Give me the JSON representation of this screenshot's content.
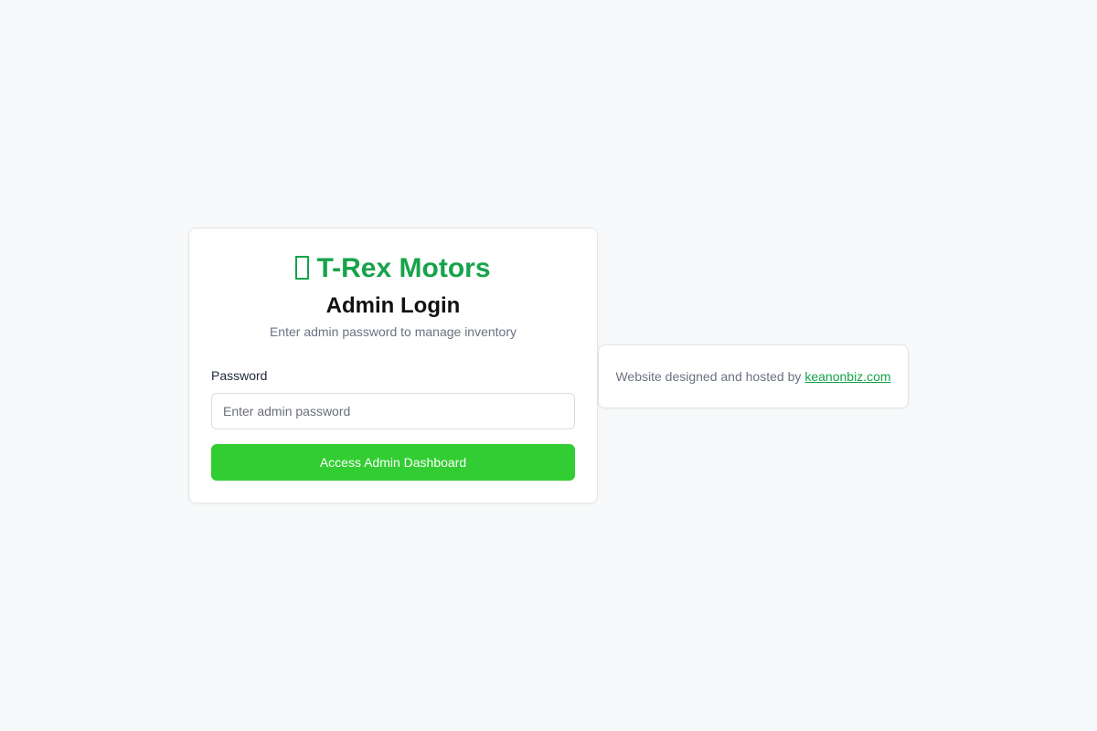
{
  "brand": {
    "icon": "dinosaur-icon",
    "name": "T-Rex Motors",
    "color": "#16a34a"
  },
  "login": {
    "title": "Admin Login",
    "subtitle": "Enter admin password to manage inventory",
    "password_label": "Password",
    "password_placeholder": "Enter admin password",
    "password_value": "",
    "submit_label": "Access Admin Dashboard",
    "button_color": "#32cd32"
  },
  "footer": {
    "text": "Website designed and hosted by",
    "link_text": "keanonbiz.com"
  }
}
